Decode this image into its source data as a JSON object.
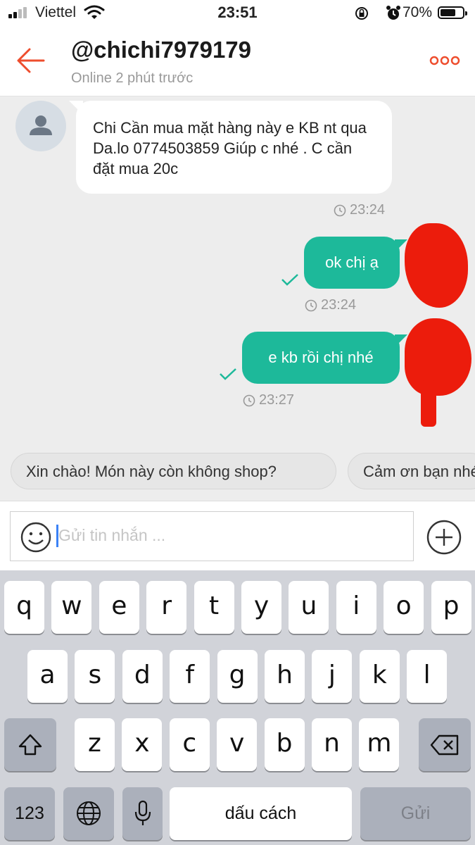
{
  "status_bar": {
    "carrier": "Viettel",
    "time": "23:51",
    "battery": "70%",
    "battery_level": 0.7
  },
  "header": {
    "back_icon": "arrow-left-icon",
    "title": "@chichi7979179",
    "subtitle": "Online 2 phút trước",
    "more_icon": "more-dots-icon"
  },
  "messages": [
    {
      "direction": "incoming",
      "text": "Chi Cần mua mặt hàng này e KB nt qua Da.lo 0774503859 Giúp c nhé . C cần đặt mua 20c",
      "time": "23:24"
    },
    {
      "direction": "outgoing",
      "text": "ok chị ạ",
      "time": "23:24",
      "status": "sent"
    },
    {
      "direction": "outgoing",
      "text": "e kb rồi chị nhé",
      "time": "23:27",
      "status": "sent"
    }
  ],
  "quick_replies": [
    "Xin chào! Món này còn không shop?",
    "Cảm ơn bạn nhé!"
  ],
  "composer": {
    "placeholder": "Gửi tin nhắn ..."
  },
  "keyboard": {
    "row1": [
      "q",
      "w",
      "e",
      "r",
      "t",
      "y",
      "u",
      "i",
      "o",
      "p"
    ],
    "row2": [
      "a",
      "s",
      "d",
      "f",
      "g",
      "h",
      "j",
      "k",
      "l"
    ],
    "row3": [
      "z",
      "x",
      "c",
      "v",
      "b",
      "n",
      "m"
    ],
    "numbers": "123",
    "space": "dấu cách",
    "send": "Gửi"
  },
  "colors": {
    "accent": "#ee4d2d",
    "bubble_out": "#1db99a",
    "redaction": "#ec1c0c"
  }
}
